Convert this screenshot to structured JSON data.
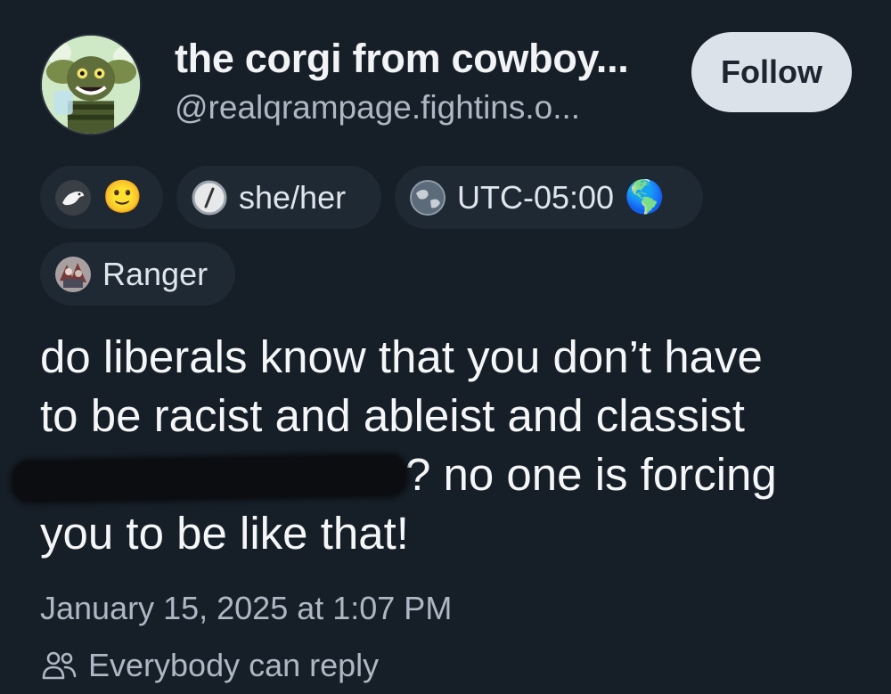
{
  "profile": {
    "display_name": "the corgi from cowboy...",
    "handle": "@realqrampage.fightins.o...",
    "follow_label": "Follow"
  },
  "badges": [
    {
      "icon": "bird-avatar-icon",
      "emoji": "🙂"
    },
    {
      "icon": "slash-circle-icon",
      "label": "she/her"
    },
    {
      "icon": "globe-icon",
      "label": "UTC-05:00",
      "emoji": "🌎"
    },
    {
      "icon": "ranger-avatar-icon",
      "label": "Ranger"
    }
  ],
  "post": {
    "line1": "do liberals know that you don’t have",
    "line2": "to be racist and ableist and classist",
    "line3_after_redaction": "? no one is forcing",
    "line4": "you to be like that!"
  },
  "meta": {
    "timestamp": "January 15, 2025 at 1:07 PM",
    "reply_setting": "Everybody can reply"
  },
  "colors": {
    "background": "#161e27",
    "pill_background": "#1f2933",
    "follow_button": "#dce2ea",
    "muted_text": "#aeb8c4"
  }
}
